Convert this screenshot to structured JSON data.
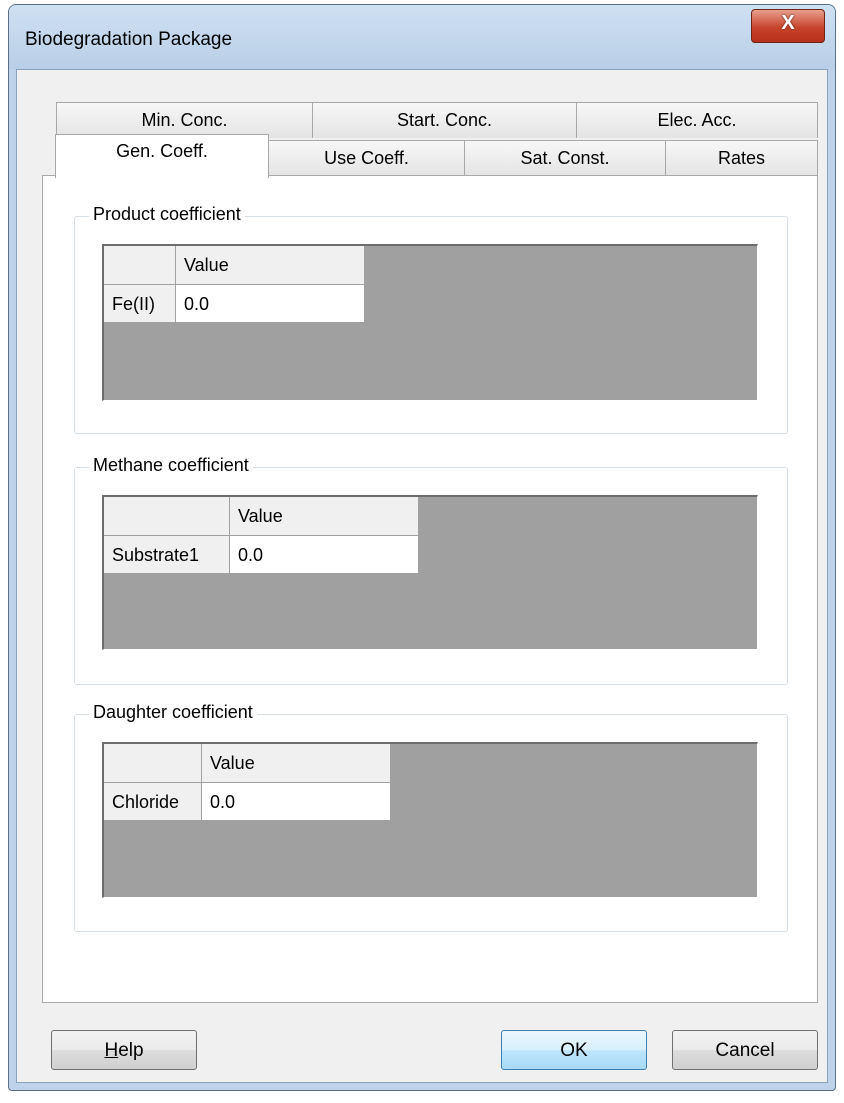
{
  "window": {
    "title": "Biodegradation Package",
    "close_glyph": "X"
  },
  "tabs": {
    "row_back": [
      {
        "label": "Min. Conc."
      },
      {
        "label": "Start. Conc."
      },
      {
        "label": "Elec. Acc."
      }
    ],
    "row_front": [
      {
        "label": "Gen. Coeff.",
        "selected": true
      },
      {
        "label": "Use Coeff."
      },
      {
        "label": "Sat. Const."
      },
      {
        "label": "Rates"
      }
    ]
  },
  "groups": [
    {
      "label": "Product coefficient",
      "column_header": "Value",
      "row_label": "Fe(II)",
      "value": "0.0"
    },
    {
      "label": "Methane coefficient",
      "column_header": "Value",
      "row_label": "Substrate1",
      "value": "0.0"
    },
    {
      "label": "Daughter coefficient",
      "column_header": "Value",
      "row_label": "Chloride",
      "value": "0.0"
    }
  ],
  "buttons": {
    "help_first": "H",
    "help_rest": "elp",
    "ok": "OK",
    "cancel": "Cancel"
  },
  "colors": {
    "grid_background": "#a0a0a0",
    "default_button": "#bee6fd",
    "close_button": "#c7432b"
  }
}
